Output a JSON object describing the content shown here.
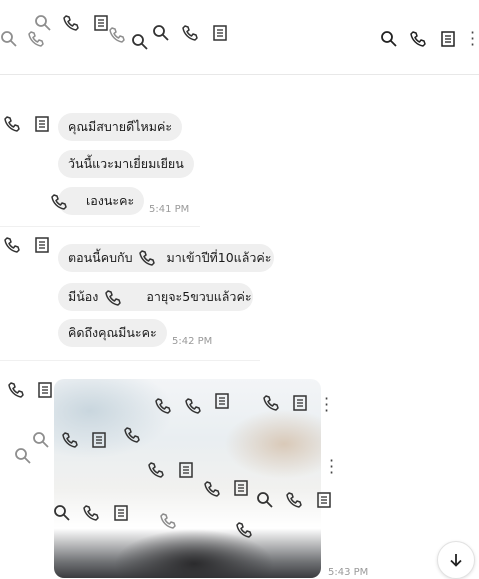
{
  "header": {
    "actions": [
      "search-icon",
      "phone-icon",
      "note-icon",
      "more-icon"
    ]
  },
  "messages": {
    "group1": {
      "lines": [
        "คุณมีสบายดีไหมค่ะ",
        "วันนี้แวะมาเยี่ยมเยียน",
        "เองนะคะ"
      ],
      "time": "5:41 PM"
    },
    "group2": {
      "lines": [
        "ตอนนี้คบกับ",
        "มาเข้าปีที่10แล้วค่ะ",
        "มีน้อง",
        "อายุจะ5ขวบแล้วค่ะ",
        "คิดถึงคุณมีนะคะ"
      ],
      "time": "5:42 PM"
    },
    "group3": {
      "photo": "photo-message",
      "time": "5:43 PM"
    }
  },
  "scroll": {
    "icon": "arrow-down-icon"
  },
  "colors": {
    "bubble": "#efefef",
    "time": "#9a9a9a",
    "icon": "#333333"
  }
}
